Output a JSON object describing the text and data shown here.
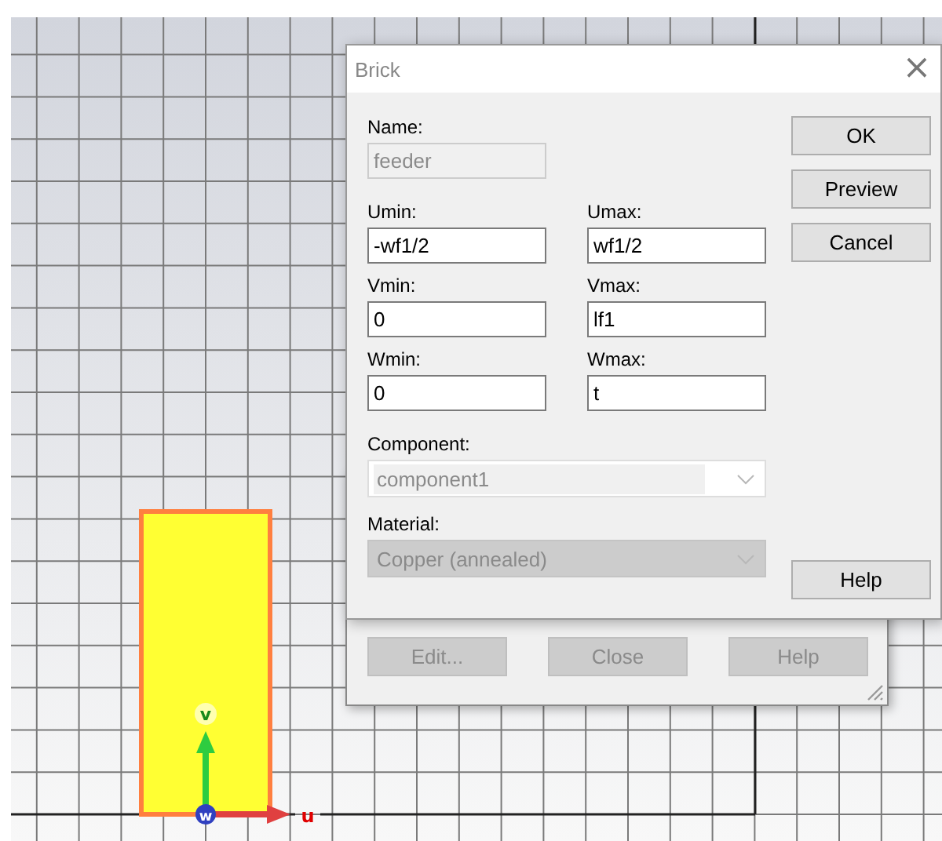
{
  "viewport": {
    "axes": [
      {
        "kind": "u",
        "label": "u"
      },
      {
        "kind": "v",
        "label": "v"
      },
      {
        "kind": "w",
        "label": "w"
      }
    ]
  },
  "background_dialog": {
    "buttons": [
      {
        "label": "Edit...",
        "disabled": true
      },
      {
        "label": "Close",
        "disabled": true
      },
      {
        "label": "Help",
        "disabled": true
      }
    ]
  },
  "dialog": {
    "title": "Brick",
    "close": "×",
    "name_field": {
      "label": "Name:",
      "value": "feeder",
      "disabled": true
    },
    "coordinate_fields": [
      {
        "label": "Umin:",
        "value": "-wf1/2",
        "disabled": false
      },
      {
        "label": "Umax:",
        "value": "wf1/2",
        "disabled": false
      },
      {
        "label": "Vmin:",
        "value": "0",
        "disabled": false
      },
      {
        "label": "Vmax:",
        "value": "lf1",
        "disabled": false
      },
      {
        "label": "Wmin:",
        "value": "0",
        "disabled": false
      },
      {
        "label": "Wmax:",
        "value": "t",
        "disabled": false
      }
    ],
    "selects": [
      {
        "kind": "combo",
        "label": "Component:",
        "value": "component1",
        "disabled": true
      },
      {
        "kind": "list",
        "label": "Material:",
        "value": "Copper (annealed)",
        "disabled": true
      }
    ],
    "buttons": [
      {
        "label": "OK",
        "disabled": false
      },
      {
        "label": "Preview",
        "disabled": false
      },
      {
        "label": "Cancel",
        "disabled": false
      },
      {
        "label": "Help",
        "disabled": false
      }
    ]
  }
}
